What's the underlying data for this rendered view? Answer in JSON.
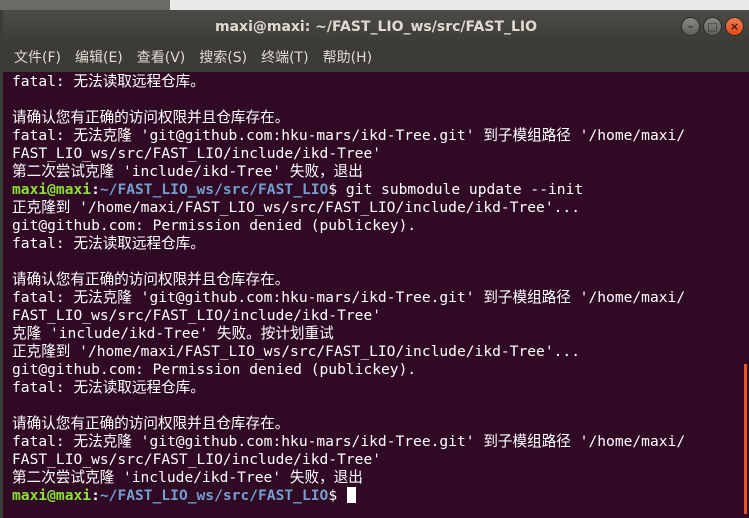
{
  "window": {
    "title": "maxi@maxi: ~/FAST_LIO_ws/src/FAST_LIO",
    "buttons": [
      "minimize-icon",
      "maximize-icon",
      "close-icon"
    ]
  },
  "menu": [
    "文件(F)",
    "编辑(E)",
    "查看(V)",
    "搜索(S)",
    "终端(T)",
    "帮助(H)"
  ],
  "prompt": {
    "user": "maxi@maxi",
    "colon": ":",
    "path": "~/FAST_LIO_ws/src/FAST_LIO",
    "symbol": "$"
  },
  "terminal_lines": [
    {
      "text": "fatal: 无法读取远程仓库。"
    },
    {
      "text": ""
    },
    {
      "text": "请确认您有正确的访问权限并且仓库存在。"
    },
    {
      "text": "fatal: 无法克隆 'git@github.com:hku-mars/ikd-Tree.git' 到子模组路径 '/home/maxi/"
    },
    {
      "text": "FAST_LIO_ws/src/FAST_LIO/include/ikd-Tree'"
    },
    {
      "text": "第二次尝试克隆 'include/ikd-Tree' 失败，退出"
    },
    {
      "prompt": true,
      "text": " git submodule update --init"
    },
    {
      "text": "正克隆到 '/home/maxi/FAST_LIO_ws/src/FAST_LIO/include/ikd-Tree'..."
    },
    {
      "text": "git@github.com: Permission denied (publickey)."
    },
    {
      "text": "fatal: 无法读取远程仓库。"
    },
    {
      "text": ""
    },
    {
      "text": "请确认您有正确的访问权限并且仓库存在。"
    },
    {
      "text": "fatal: 无法克隆 'git@github.com:hku-mars/ikd-Tree.git' 到子模组路径 '/home/maxi/"
    },
    {
      "text": "FAST_LIO_ws/src/FAST_LIO/include/ikd-Tree'"
    },
    {
      "text": "克隆 'include/ikd-Tree' 失败。按计划重试"
    },
    {
      "text": "正克隆到 '/home/maxi/FAST_LIO_ws/src/FAST_LIO/include/ikd-Tree'..."
    },
    {
      "text": "git@github.com: Permission denied (publickey)."
    },
    {
      "text": "fatal: 无法读取远程仓库。"
    },
    {
      "text": ""
    },
    {
      "text": "请确认您有正确的访问权限并且仓库存在。"
    },
    {
      "text": "fatal: 无法克隆 'git@github.com:hku-mars/ikd-Tree.git' 到子模组路径 '/home/maxi/"
    },
    {
      "text": "FAST_LIO_ws/src/FAST_LIO/include/ikd-Tree'"
    },
    {
      "text": "第二次尝试克隆 'include/ikd-Tree' 失败，退出"
    },
    {
      "prompt": true,
      "text": " ",
      "cursor": true
    }
  ],
  "colors": {
    "terminal_bg": "#300a24",
    "prompt_user": "#8ae234",
    "prompt_path": "#729fcf",
    "scroll_thumb": "#e95420"
  }
}
